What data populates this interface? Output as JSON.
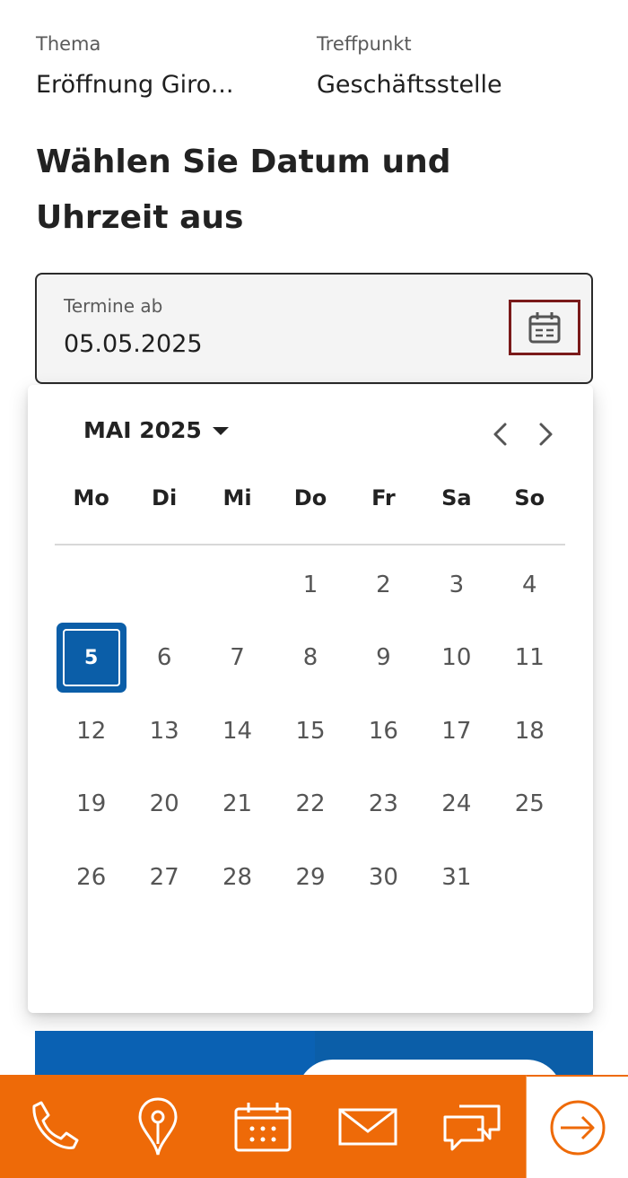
{
  "summary": {
    "topic_label": "Thema",
    "topic_value": "Eröffnung Giro...",
    "location_label": "Treffpunkt",
    "location_value": "Geschäftsstelle"
  },
  "heading": "Wählen Sie Datum und Uhrzeit aus",
  "date_field": {
    "label": "Termine ab",
    "value": "05.05.2025",
    "icon": "calendar-icon"
  },
  "datepicker": {
    "month_label": "MAI 2025",
    "weekdays": [
      "Mo",
      "Di",
      "Mi",
      "Do",
      "Fr",
      "Sa",
      "So"
    ],
    "leading_blanks": 3,
    "days": [
      "1",
      "2",
      "3",
      "4",
      "5",
      "6",
      "7",
      "8",
      "9",
      "10",
      "11",
      "12",
      "13",
      "14",
      "15",
      "16",
      "17",
      "18",
      "19",
      "20",
      "21",
      "22",
      "23",
      "24",
      "25",
      "26",
      "27",
      "28",
      "29",
      "30",
      "31"
    ],
    "selected_day": "5",
    "selected_color": "#0b5ea8"
  },
  "bottom_bar": {
    "background": "#ee6a08",
    "items": [
      "phone-icon",
      "location-pin-icon",
      "calendar-icon",
      "mail-icon",
      "chat-icon"
    ],
    "login_icon": "arrow-right-circle-icon"
  }
}
